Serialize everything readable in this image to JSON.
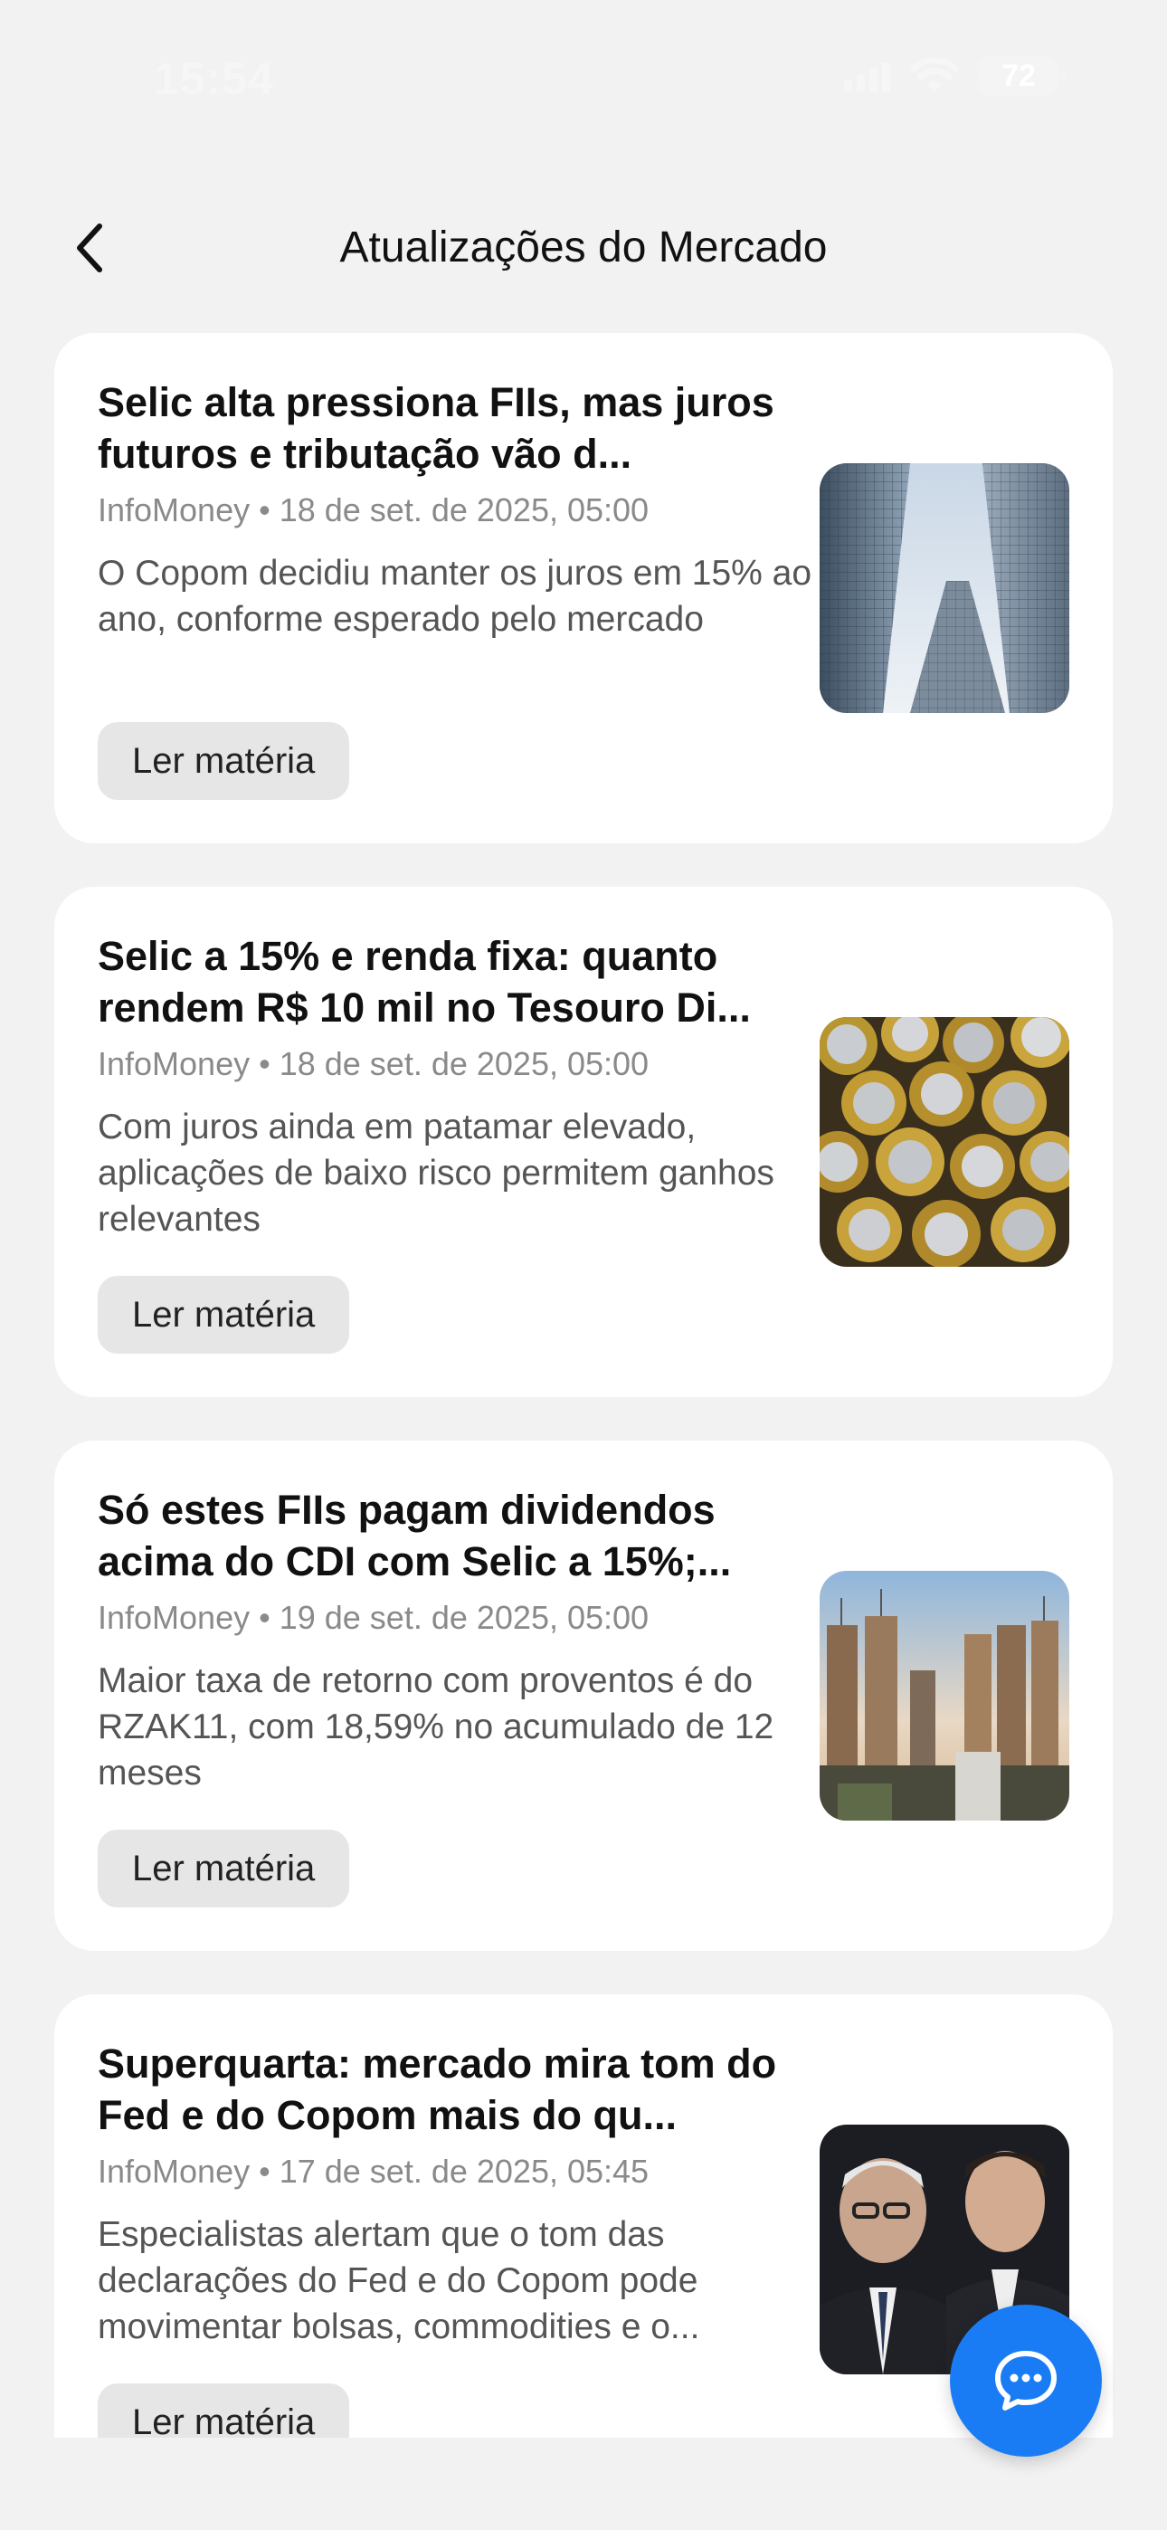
{
  "status_bar": {
    "time": "15:54",
    "battery": "72"
  },
  "header": {
    "title": "Atualizações do Mercado",
    "back_icon": "chevron-left-icon"
  },
  "articles": [
    {
      "title": "Selic alta pressiona FIIs, mas juros futuros e tributação vão d...",
      "source": "InfoMoney",
      "separator": "•",
      "date": "18 de set. de 2025, 05:00",
      "summary": "O Copom decidiu manter os juros em 15% ao ano, conforme esperado pelo mercado",
      "button_label": "Ler matéria",
      "image": "skyscrapers-photo"
    },
    {
      "title": "Selic a 15% e renda fixa: quanto rendem R$ 10 mil no Tesouro Di...",
      "source": "InfoMoney",
      "separator": "•",
      "date": "18 de set. de 2025, 05:00",
      "summary": "Com juros ainda em patamar elevado, aplicações de baixo risco permitem ganhos relevantes",
      "button_label": "Ler matéria",
      "image": "coins-photo"
    },
    {
      "title": "Só estes FIIs pagam dividendos acima do CDI com Selic a 15%;...",
      "source": "InfoMoney",
      "separator": "•",
      "date": "19 de set. de 2025, 05:00",
      "summary": "Maior taxa de retorno com proventos é do RZAK11, com 18,59% no acumulado de 12 meses",
      "button_label": "Ler matéria",
      "image": "city-skyline-photo"
    },
    {
      "title": "Superquarta: mercado mira tom do Fed e do Copom mais do qu...",
      "source": "InfoMoney",
      "separator": "•",
      "date": "17 de set. de 2025, 05:45",
      "summary": "Especialistas alertam que o tom das declarações do Fed e do Copom pode movimentar bolsas, commodities e o...",
      "button_label": "Ler matéria",
      "image": "central-bankers-photo"
    }
  ],
  "fab": {
    "icon": "chat-bubble-icon"
  },
  "colors": {
    "accent": "#1a7cf5",
    "background": "#f2f2f2",
    "card": "#ffffff",
    "button": "#e6e6e6"
  }
}
